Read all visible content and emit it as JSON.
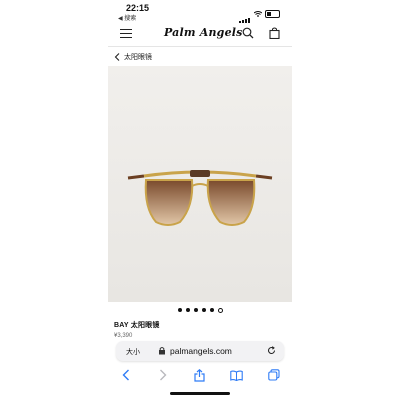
{
  "status_bar": {
    "time": "22:15",
    "back_app": "◀ 搜索"
  },
  "header": {
    "brand": "Palm Angels"
  },
  "breadcrumb": {
    "label": "太阳眼镜"
  },
  "gallery": {
    "total_dots": 6,
    "active_index": 5
  },
  "product": {
    "title": "BAY 太阳眼镜",
    "price_partial": "¥3,390"
  },
  "browser": {
    "aa_label": "大小",
    "url": "palmangels.com"
  },
  "colors": {
    "accent": "#111111",
    "background": "#ffffff",
    "image_bg": "#ece9e5"
  }
}
